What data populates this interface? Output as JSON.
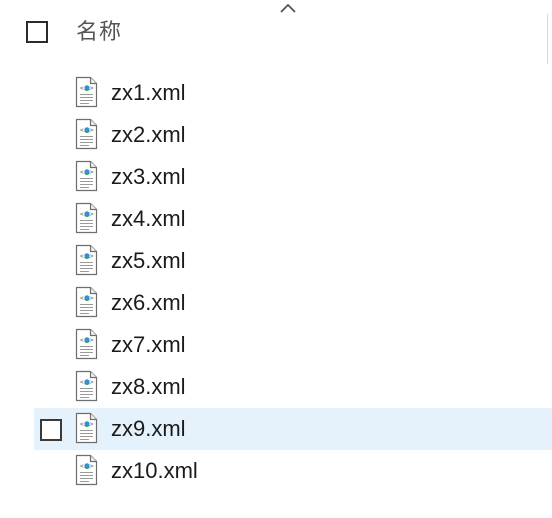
{
  "header": {
    "column_label": "名称",
    "sort_indicator_icon": "chevron-up-icon"
  },
  "files": [
    {
      "name": "zx1.xml"
    },
    {
      "name": "zx2.xml"
    },
    {
      "name": "zx3.xml"
    },
    {
      "name": "zx4.xml"
    },
    {
      "name": "zx5.xml"
    },
    {
      "name": "zx6.xml"
    },
    {
      "name": "zx7.xml"
    },
    {
      "name": "zx8.xml"
    },
    {
      "name": "zx9.xml",
      "hovered": true
    },
    {
      "name": "zx10.xml"
    }
  ],
  "colors": {
    "hover_bg": "#e5f1fb",
    "text": "#1b1b1b",
    "header_text": "#555555"
  },
  "file_icon": "xml-file-icon"
}
